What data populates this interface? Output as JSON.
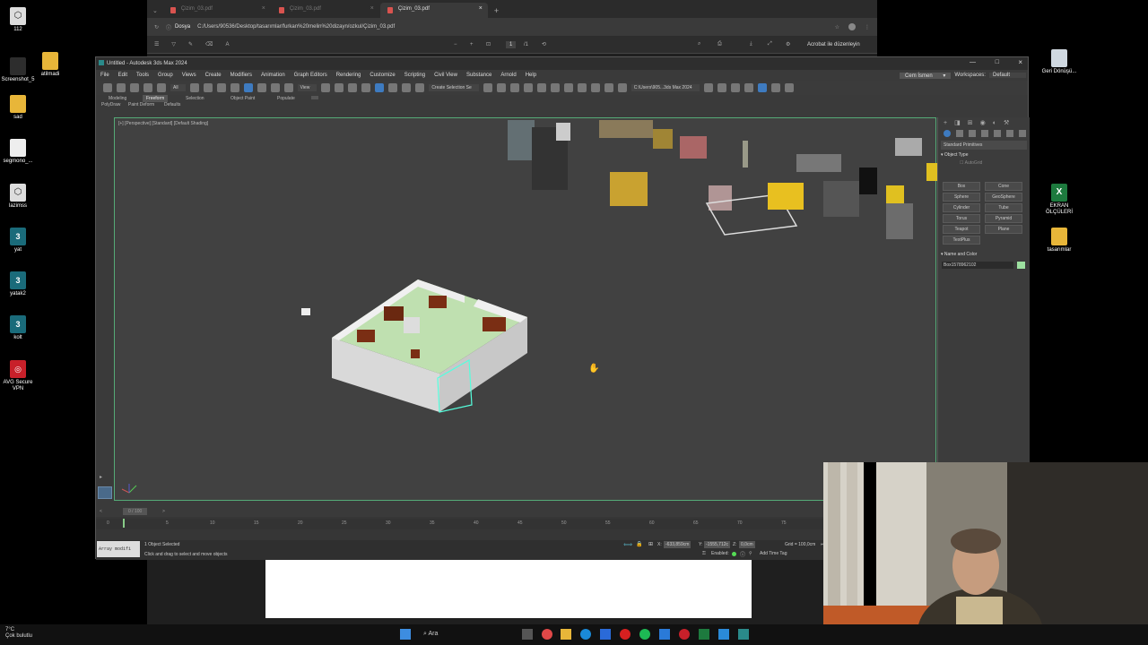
{
  "desktop": {
    "left_icons": [
      {
        "label": "112",
        "icon": "3d-cube-icon"
      },
      {
        "label": "Screenshot_5",
        "icon": "screenshot-icon"
      },
      {
        "label": "atilmadi",
        "icon": "folder-icon"
      },
      {
        "label": "sad",
        "icon": "folder-icon"
      },
      {
        "label": "segmono_...",
        "icon": "file-icon"
      },
      {
        "label": "lazimss",
        "icon": "3d-cube-icon"
      },
      {
        "label": "yat",
        "icon": "3dsmax-file-icon"
      },
      {
        "label": "yatak2",
        "icon": "3dsmax-file-icon"
      },
      {
        "label": "kolt",
        "icon": "3dsmax-file-icon"
      },
      {
        "label": "AVG Secure VPN",
        "icon": "vpn-icon"
      }
    ],
    "right_icons": [
      {
        "label": "Geri Dönüşü...",
        "icon": "recycle-bin-icon"
      },
      {
        "label": "EKRAN ÖLÇÜLERİ",
        "icon": "excel-file-icon"
      },
      {
        "label": "tasarımlar",
        "icon": "folder-icon"
      }
    ]
  },
  "browser": {
    "tabs": [
      {
        "label": "Çizim_03.pdf"
      },
      {
        "label": "Çizim_03.pdf"
      },
      {
        "label": "Çizim_03.pdf"
      }
    ],
    "address_label": "Dosya",
    "url": "C:/Users/90536/Desktop/tasarımlar/furkan%20melin%20dizayn/ozkul/Çizim_03.pdf",
    "page_current": "1",
    "page_total": "/1",
    "edit_acrobat": "Acrobat ile düzenleyin"
  },
  "max": {
    "title": "Untitled - Autodesk 3ds Max 2024",
    "menu": [
      "File",
      "Edit",
      "Tools",
      "Group",
      "Views",
      "Create",
      "Modifiers",
      "Animation",
      "Graph Editors",
      "Rendering",
      "Customize",
      "Scripting",
      "Civil View",
      "Substance",
      "Arnold",
      "Help"
    ],
    "user": "Cem İsmen",
    "workspace_label": "Workspaces:",
    "workspace_value": "Default",
    "selection_filter": "All",
    "view_dropdown": "View",
    "create_selection_set": "Create Selection Se",
    "path_dropdown": "C:\\Users\\905...3ds Max 2024",
    "ribbon_tabs": [
      "Modeling",
      "Freeform",
      "Selection",
      "Object Paint",
      "Populate"
    ],
    "ribbon_sub": [
      "PolyDraw",
      "Paint Deform",
      "Defaults"
    ],
    "viewport_label": "[+] [Perspective] [Standard] [Default Shading]",
    "cmd": {
      "category": "Standard Primitives",
      "rollout_object_type": "Object Type",
      "autogrid": "AutoGrid",
      "buttons": [
        "Box",
        "Cone",
        "Sphere",
        "GeoSphere",
        "Cylinder",
        "Tube",
        "Torus",
        "Pyramid",
        "Teapot",
        "Plane",
        "TextPlus"
      ],
      "rollout_name_color": "Name and Color",
      "object_name": "Box1578962102"
    },
    "timeline": {
      "frame": "0 / 100",
      "ticks": [
        "0",
        "5",
        "10",
        "15",
        "20",
        "25",
        "30",
        "35",
        "40",
        "45",
        "50",
        "55",
        "60",
        "65",
        "70",
        "75"
      ]
    },
    "status": {
      "script_box": "Array modifi",
      "selected": "1 Object Selected",
      "hint": "Click and drag to select and move objects",
      "x_label": "X:",
      "x": "-633,859cm",
      "y_label": "Y:",
      "y": "-1555,712c",
      "z_label": "Z:",
      "z": "0,0cm",
      "grid": "Grid = 100,0cm",
      "enabled": "Enabled:",
      "add_time_tag": "Add Time Tag"
    }
  },
  "taskbar": {
    "weather_temp": "7°C",
    "weather_text": "Çok bulutlu",
    "search": "Ara"
  }
}
